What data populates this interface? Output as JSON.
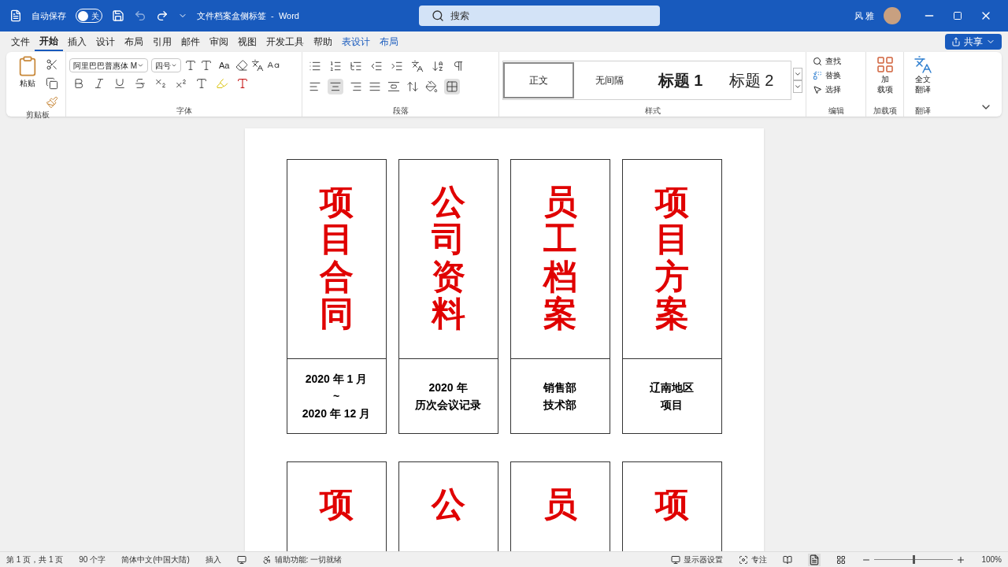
{
  "title_bar": {
    "autosave_label": "自动保存",
    "autosave": {
      "on": false,
      "label": "关"
    },
    "doc_title": "文件档案盒侧标签  -  Word",
    "search_placeholder": "搜索",
    "user": "风 雅"
  },
  "menu_tabs": [
    {
      "label": "文件",
      "selected": false,
      "contextual": false
    },
    {
      "label": "开始",
      "selected": true,
      "contextual": false
    },
    {
      "label": "插入",
      "selected": false,
      "contextual": false
    },
    {
      "label": "设计",
      "selected": false,
      "contextual": false
    },
    {
      "label": "布局",
      "selected": false,
      "contextual": false
    },
    {
      "label": "引用",
      "selected": false,
      "contextual": false
    },
    {
      "label": "邮件",
      "selected": false,
      "contextual": false
    },
    {
      "label": "审阅",
      "selected": false,
      "contextual": false
    },
    {
      "label": "视图",
      "selected": false,
      "contextual": false
    },
    {
      "label": "开发工具",
      "selected": false,
      "contextual": false
    },
    {
      "label": "帮助",
      "selected": false,
      "contextual": false
    },
    {
      "label": "表设计",
      "selected": false,
      "contextual": true
    },
    {
      "label": "布局",
      "selected": false,
      "contextual": true
    }
  ],
  "share": "共享",
  "ribbon": {
    "clipboard": {
      "paste": "粘贴",
      "label": "剪贴板"
    },
    "font": {
      "font_name": "阿里巴巴普惠体 M",
      "font_size": "四号",
      "case_button": "Aa",
      "label": "字体"
    },
    "paragraph": {
      "label": "段落"
    },
    "styles": {
      "items": [
        {
          "label": "正文",
          "selected": true
        },
        {
          "label": "无间隔",
          "selected": false
        },
        {
          "label": "标题 1",
          "selected": false
        },
        {
          "label": "标题 2",
          "selected": false
        }
      ],
      "label": "样式"
    },
    "editing": {
      "find": "查找",
      "replace": "替换",
      "select": "选择",
      "label": "编辑"
    },
    "addins": {
      "button": [
        "加",
        "载项"
      ],
      "label": "加载项"
    },
    "translate": {
      "button": [
        "全文",
        "翻译"
      ],
      "label": "翻译"
    }
  },
  "document": {
    "rows": [
      {
        "labels": [
          {
            "title": "项目合同",
            "lines": [
              "2020 年 1 月",
              "~",
              "2020 年 12 月"
            ]
          },
          {
            "title": "公司资料",
            "lines": [
              "2020 年",
              "历次会议记录"
            ]
          },
          {
            "title": "员工档案",
            "lines": [
              "销售部",
              "技术部"
            ]
          },
          {
            "title": "项目方案",
            "lines": [
              "辽南地区",
              "项目"
            ]
          }
        ]
      },
      {
        "labels": [
          {
            "title": "项"
          },
          {
            "title": "公"
          },
          {
            "title": "员"
          },
          {
            "title": "项"
          }
        ]
      }
    ]
  },
  "status_bar": {
    "page": "第 1 页，共 1 页",
    "words": "90 个字",
    "language": "简体中文(中国大陆)",
    "mode": "插入",
    "accessibility": "辅助功能: 一切就绪",
    "display": "显示器设置",
    "focus": "专注",
    "zoom": {
      "level": 0.5,
      "reading": "100%"
    }
  }
}
